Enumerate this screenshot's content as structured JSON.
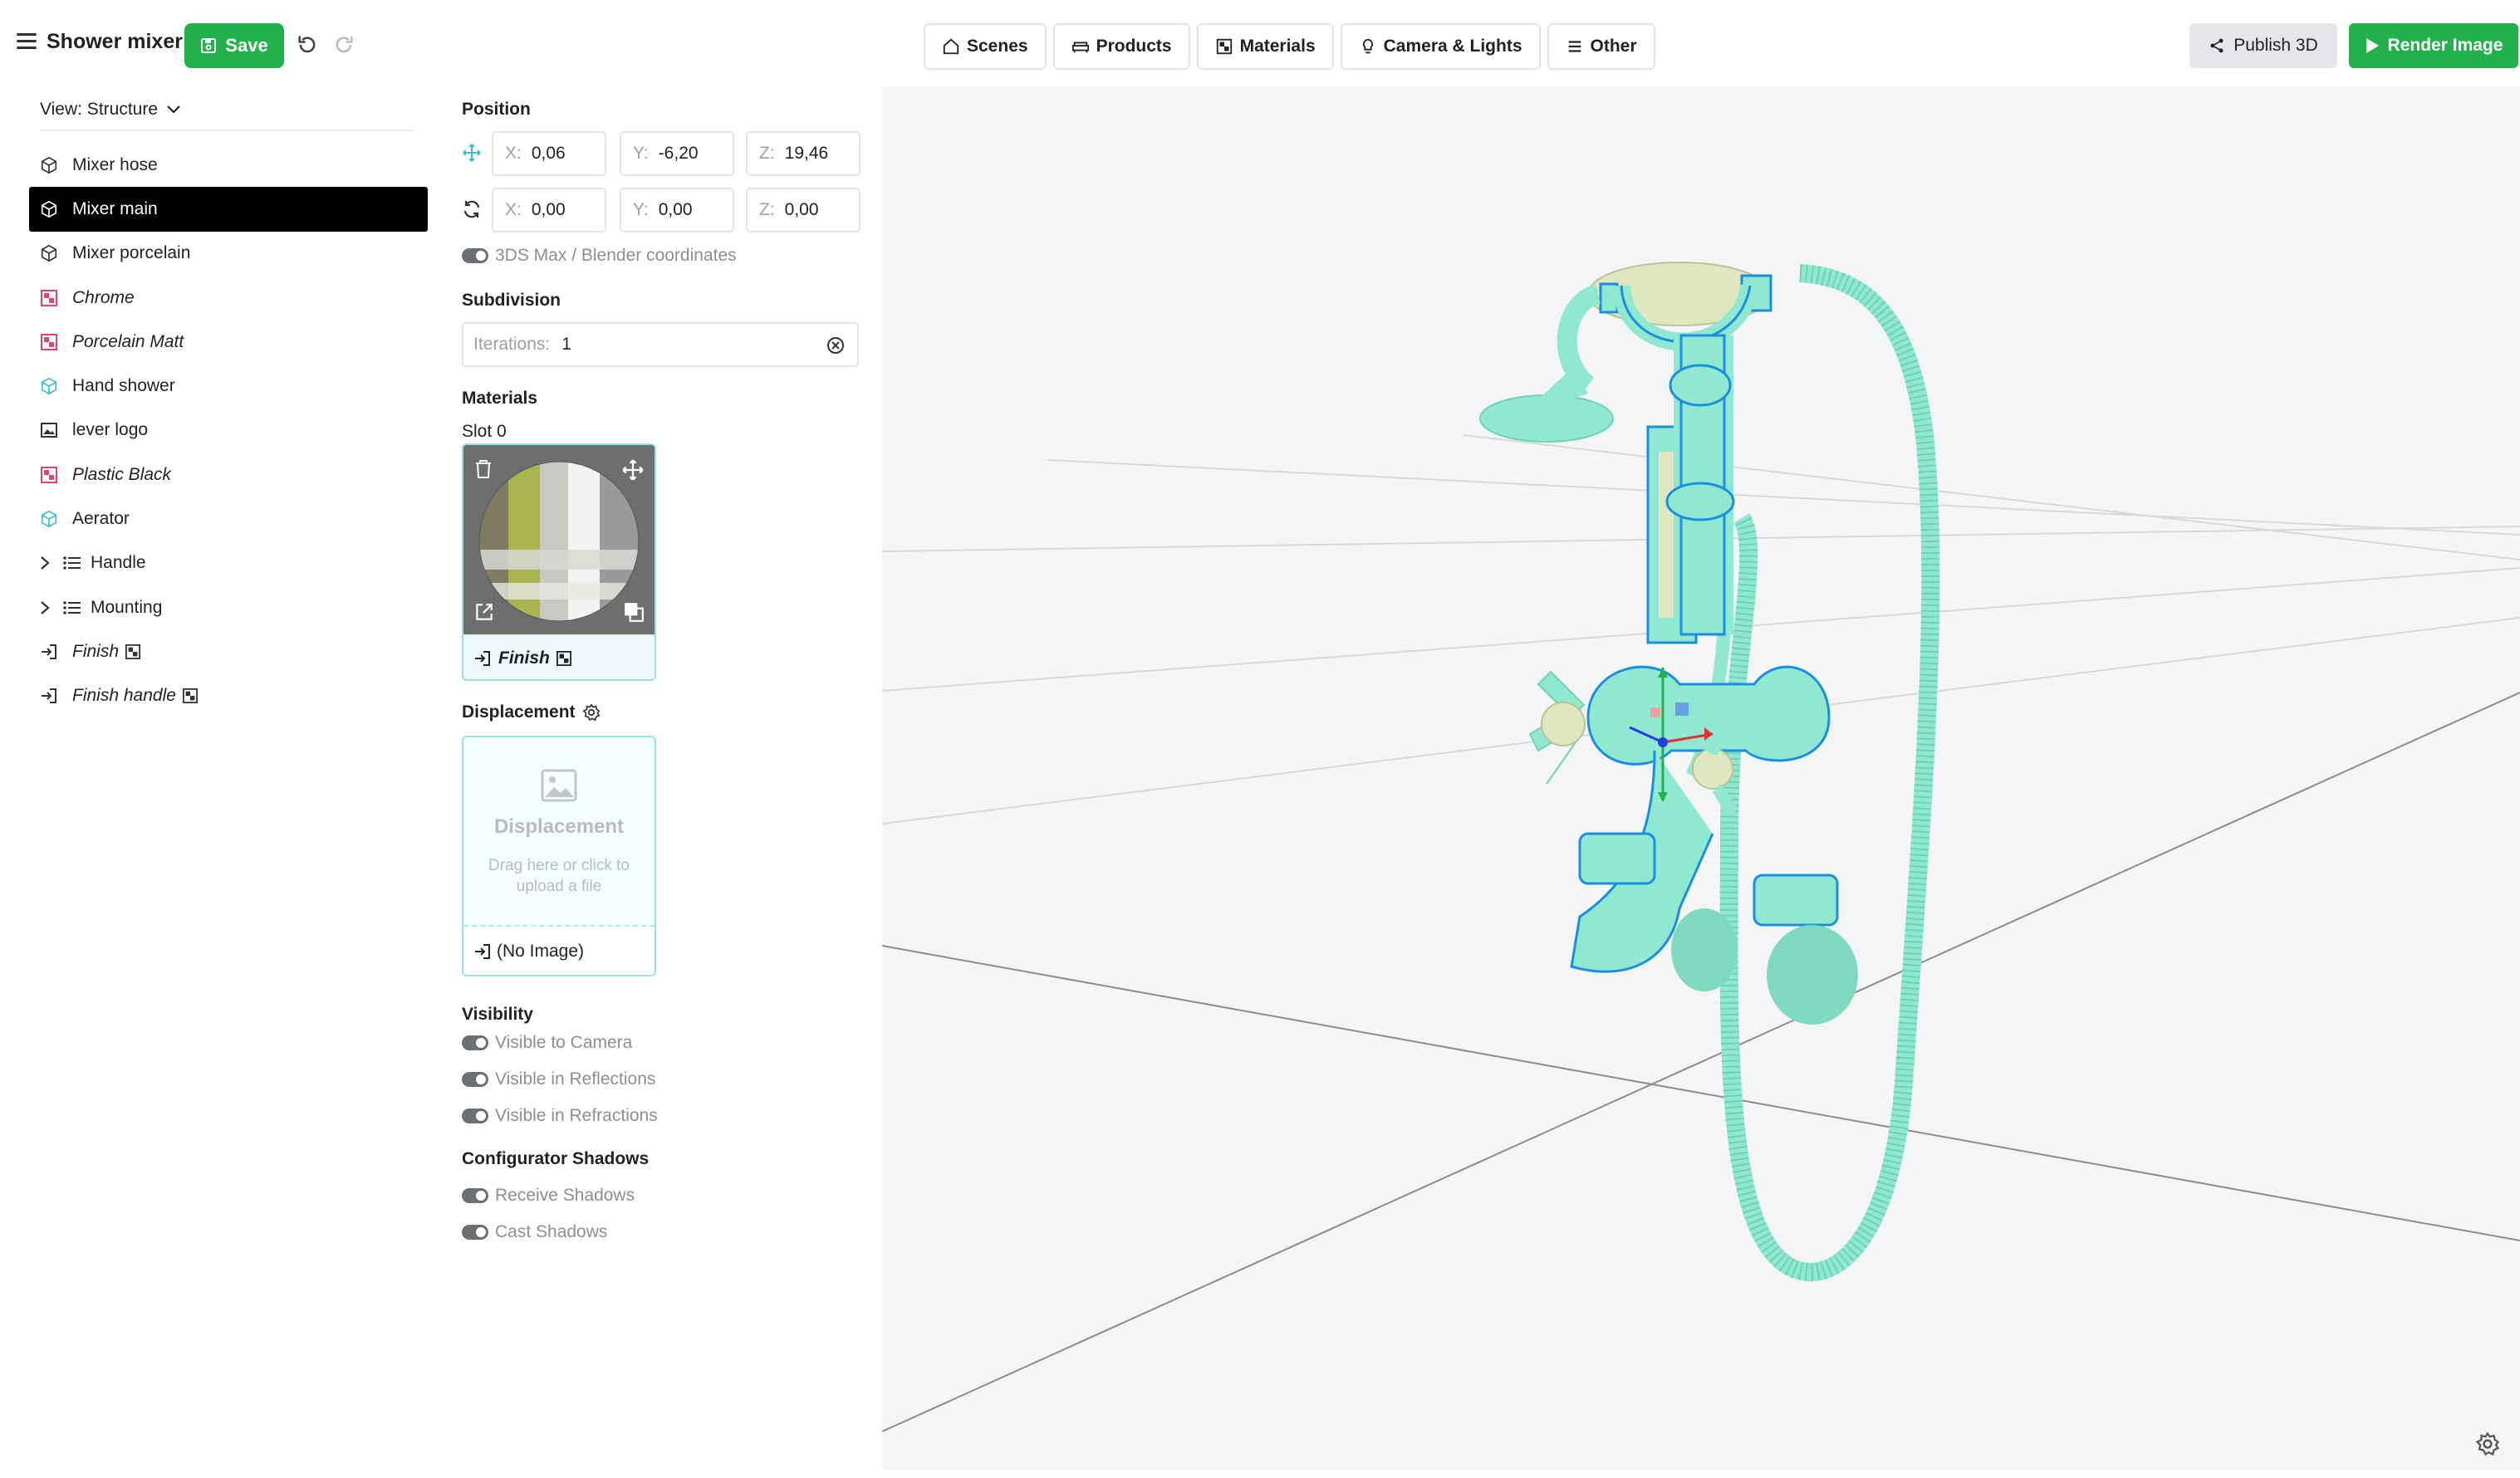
{
  "app": {
    "title": "Shower mixer",
    "save_label": "Save"
  },
  "topnav": {
    "tabs": [
      {
        "label": "Scenes",
        "icon": "home-icon"
      },
      {
        "label": "Products",
        "icon": "sofa-icon"
      },
      {
        "label": "Materials",
        "icon": "material-icon"
      },
      {
        "label": "Camera & Lights",
        "icon": "bulb-icon"
      },
      {
        "label": "Other",
        "icon": "list-icon"
      }
    ],
    "publish_label": "Publish 3D",
    "render_label": "Render Image"
  },
  "structure": {
    "view_label": "View: Structure",
    "items": [
      {
        "label": "Mixer hose",
        "icon": "cube-icon"
      },
      {
        "label": "Mixer main",
        "icon": "cube-icon",
        "selected": true
      },
      {
        "label": "Mixer porcelain",
        "icon": "cube-icon"
      },
      {
        "label": "Chrome",
        "icon": "material-icon"
      },
      {
        "label": "Porcelain Matt",
        "icon": "material-icon"
      },
      {
        "label": "Hand shower",
        "icon": "cube-icon"
      },
      {
        "label": "lever logo",
        "icon": "image-icon"
      },
      {
        "label": "Plastic Black",
        "icon": "material-icon"
      },
      {
        "label": "Aerator",
        "icon": "cube-icon"
      },
      {
        "label": "Handle",
        "icon": "list-icon"
      },
      {
        "label": "Mounting",
        "icon": "list-icon"
      },
      {
        "label": "Finish",
        "icon": "link-icon"
      },
      {
        "label": "Finish handle",
        "icon": "link-icon"
      }
    ]
  },
  "properties": {
    "position": {
      "title": "Position",
      "translate": {
        "x_label": "X:",
        "x": "0,06",
        "y_label": "Y:",
        "y": "-6,20",
        "z_label": "Z:",
        "z": "19,46"
      },
      "rotate": {
        "x_label": "X:",
        "x": "0,00",
        "y_label": "Y:",
        "y": "0,00",
        "z_label": "Z:",
        "z": "0,00"
      },
      "coords_toggle": "3DS Max / Blender coordinates"
    },
    "subdivision": {
      "title": "Subdivision",
      "iterations_label": "Iterations:",
      "iterations": "1"
    },
    "materials": {
      "title": "Materials",
      "slot_label": "Slot 0",
      "material_name": "Finish"
    },
    "displacement": {
      "title": "Displacement",
      "drop_title": "Displacement",
      "drop_hint": "Drag here or click to upload a file",
      "value": "(No Image)"
    },
    "visibility": {
      "title": "Visibility",
      "toggles": [
        "Visible to Camera",
        "Visible in Reflections",
        "Visible in Refractions"
      ]
    },
    "shadows": {
      "title": "Configurator Shadows",
      "toggles": [
        "Receive Shadows",
        "Cast Shadows"
      ]
    }
  },
  "colors": {
    "accent": "#22b24c",
    "model": "#8fe8cf",
    "selection": "#1a8fe0"
  }
}
